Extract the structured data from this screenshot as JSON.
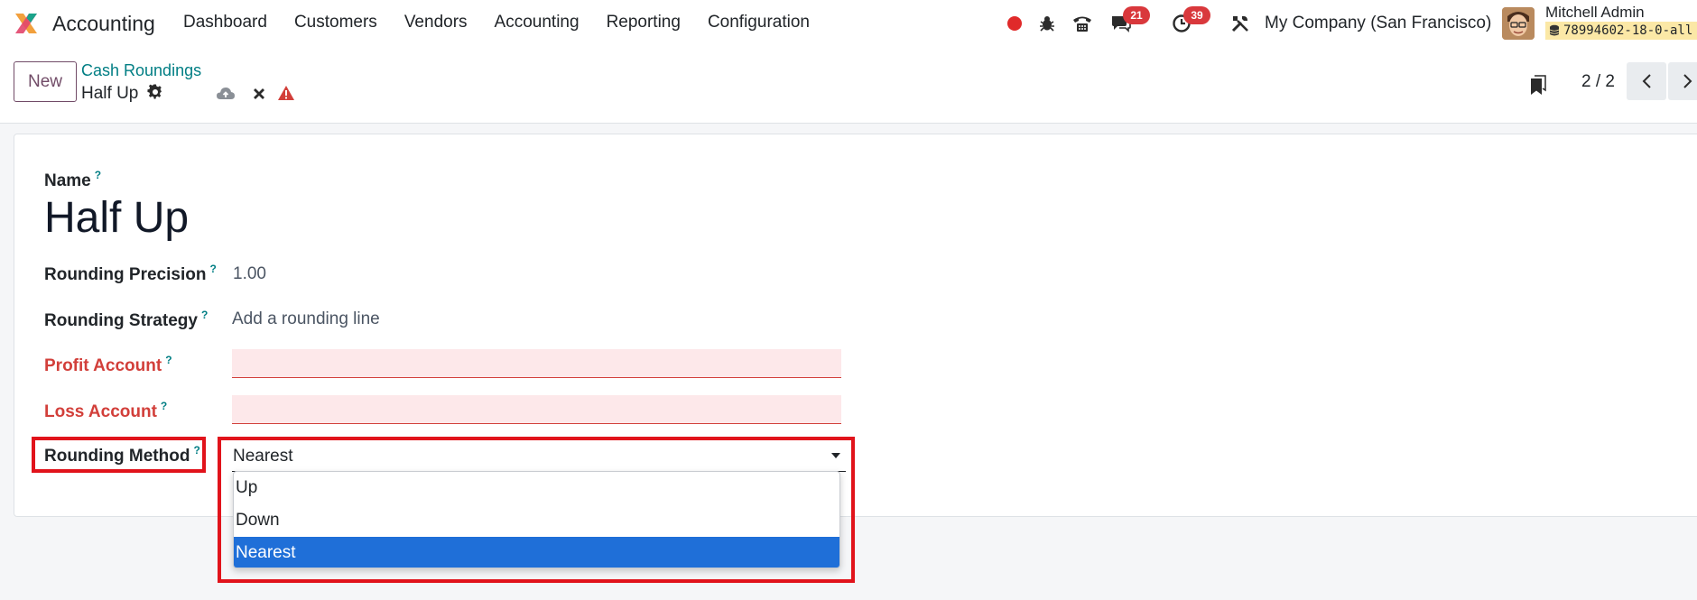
{
  "navbar": {
    "app_name": "Accounting",
    "menu": [
      "Dashboard",
      "Customers",
      "Vendors",
      "Accounting",
      "Reporting",
      "Configuration"
    ],
    "messages_count": "21",
    "activities_count": "39",
    "company": "My Company (San Francisco)",
    "user_name": "Mitchell Admin",
    "database": "78994602-18-0-all"
  },
  "control": {
    "new_label": "New",
    "breadcrumb": "Cash Roundings",
    "record_title": "Half Up",
    "pager": "2 / 2"
  },
  "form": {
    "name_label": "Name",
    "name_value": "Half Up",
    "precision_label": "Rounding Precision",
    "precision_value": "1.00",
    "strategy_label": "Rounding Strategy",
    "strategy_value": "Add a rounding line",
    "profit_label": "Profit Account",
    "loss_label": "Loss Account",
    "method_label": "Rounding Method",
    "method_value": "Nearest",
    "method_options": [
      "Up",
      "Down",
      "Nearest"
    ],
    "help_mark": "?"
  },
  "colors": {
    "brand": "#714b67",
    "link": "#017e84",
    "required": "#d23f3a",
    "selected_option": "#1f6fd8",
    "highlight": "#e1131b"
  }
}
